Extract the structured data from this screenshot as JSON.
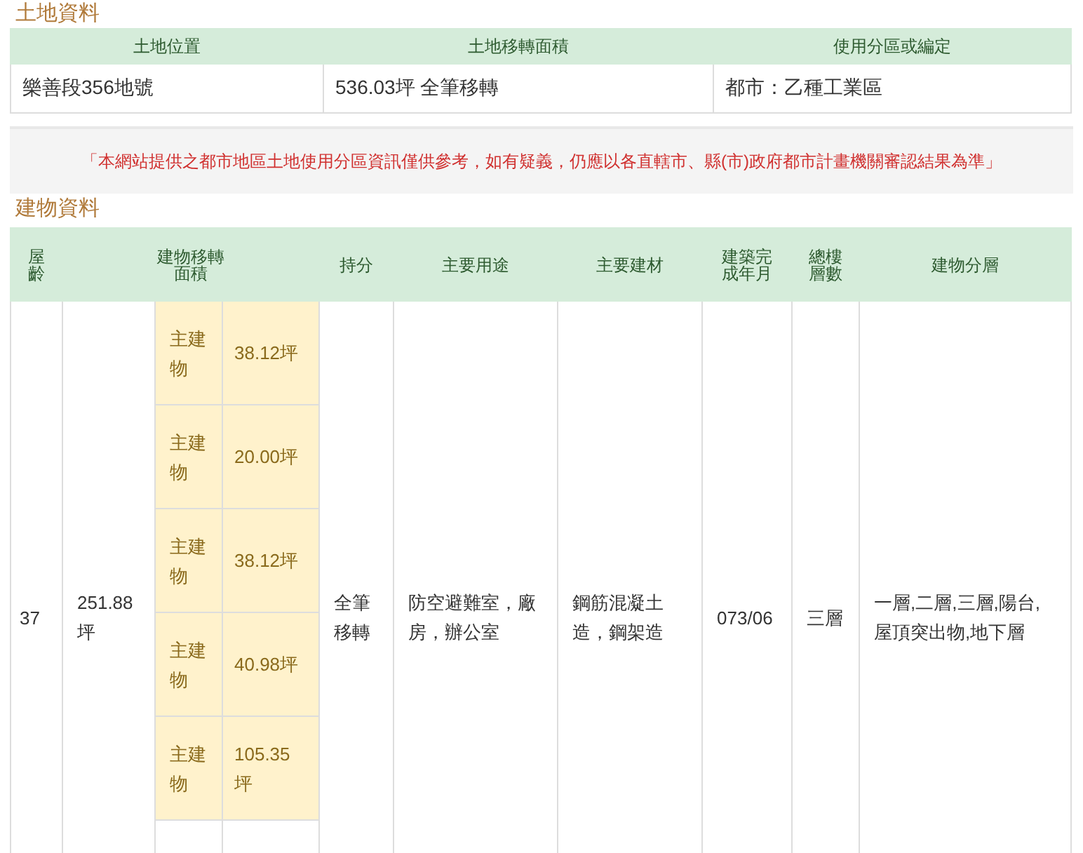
{
  "land_section": {
    "title": "土地資料",
    "columns": [
      "土地位置",
      "土地移轉面積",
      "使用分區或編定"
    ],
    "row": [
      "樂善段356地號",
      "536.03坪 全筆移轉",
      "都市：乙種工業區"
    ]
  },
  "notice": "「本網站提供之都市地區土地使用分區資訊僅供參考，如有疑義，仍應以各直轄市、縣(市)政府都市計畫機關審認結果為準」",
  "building_section": {
    "title": "建物資料",
    "columns": [
      "屋齡",
      "建物移轉面積",
      "持分",
      "主要用途",
      "主要建材",
      "建築完成年月",
      "總樓層數",
      "建物分層"
    ],
    "row": {
      "age": "37",
      "total_area": "251.88坪",
      "parts": [
        {
          "label": "主建物",
          "area": "38.12坪"
        },
        {
          "label": "主建物",
          "area": "20.00坪"
        },
        {
          "label": "主建物",
          "area": "38.12坪"
        },
        {
          "label": "主建物",
          "area": "40.98坪"
        },
        {
          "label": "主建物",
          "area": "105.35坪"
        }
      ],
      "share": "全筆移轉",
      "usage": "防空避難室，廠房，辦公室",
      "material": "鋼筋混凝土造，鋼架造",
      "completed": "073/06",
      "floors": "三層",
      "layers": "一層,二層,三層,陽台,屋頂突出物,地下層"
    }
  }
}
